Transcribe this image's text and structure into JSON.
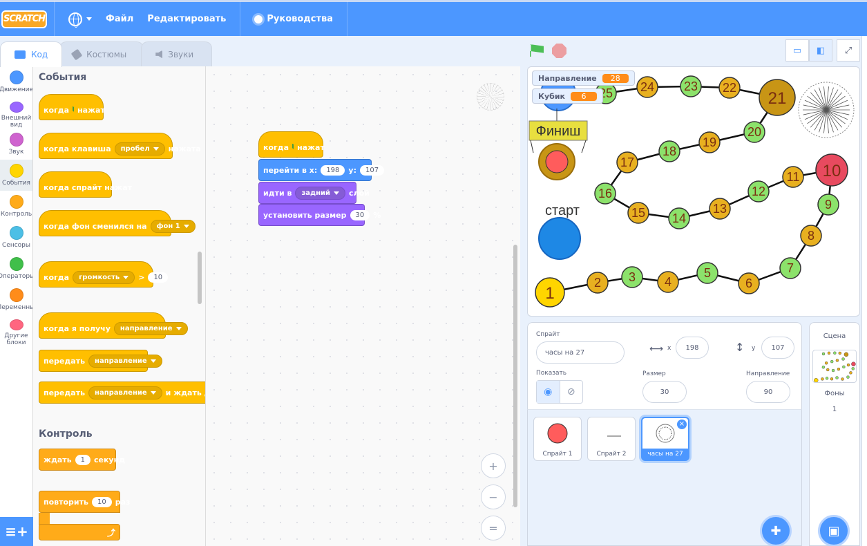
{
  "menu": {
    "logo": "SCRATCH",
    "file": "Файл",
    "edit": "Редактировать",
    "tutorials": "Руководства"
  },
  "tabs": {
    "code": "Код",
    "costumes": "Костюмы",
    "sounds": "Звуки"
  },
  "categories": [
    {
      "label": "Движение",
      "color": "#4c97ff"
    },
    {
      "label": "Внешний вид",
      "color": "#9966ff"
    },
    {
      "label": "Звук",
      "color": "#cf63cf"
    },
    {
      "label": "События",
      "color": "#ffd500"
    },
    {
      "label": "Контроль",
      "color": "#ffab19"
    },
    {
      "label": "Сенсоры",
      "color": "#4cbfe6"
    },
    {
      "label": "Операторы",
      "color": "#40bf4a"
    },
    {
      "label": "Переменные",
      "color": "#ff8c1a"
    },
    {
      "label": "Другие блоки",
      "color": "#ff6680"
    }
  ],
  "palette": {
    "events_title": "События",
    "when_flag": "когда",
    "when_flag_suffix": "нажат",
    "when_key": "когда клавиша",
    "key_value": "пробел",
    "when_key_suffix": "нажата",
    "when_sprite_clicked": "когда спрайт нажат",
    "when_backdrop": "когда фон сменился на",
    "backdrop_value": "фон 1",
    "when_loudness": "когда",
    "loudness_value": "громкость",
    "gt": ">",
    "loudness_num": "10",
    "when_receive": "когда я получу",
    "receive_value": "направление",
    "broadcast": "передать",
    "broadcast_value": "направление",
    "broadcast_wait": "передать",
    "broadcast_wait_value": "направление",
    "broadcast_wait_suffix": "и ждать до конца",
    "control_title": "Контроль",
    "wait": "ждать",
    "wait_value": "1",
    "wait_suffix": "секунд",
    "repeat": "повторить",
    "repeat_value": "10",
    "repeat_suffix": "раз"
  },
  "script": {
    "hat": "когда",
    "hat_suffix": "нажат",
    "goto": "перейти в x:",
    "goto_x": "198",
    "goto_y_label": "y:",
    "goto_y": "107",
    "layer": "идти в",
    "layer_value": "задний",
    "layer_suffix": "слой",
    "size": "установить размер",
    "size_value": "30",
    "size_suffix": "%"
  },
  "zoom": {
    "in": "+",
    "out": "−",
    "reset": "="
  },
  "stage": {
    "monitors": [
      {
        "label": "Направление",
        "value": "28"
      },
      {
        "label": "Кубик",
        "value": "6"
      }
    ],
    "finish": "Финиш",
    "start": "старт",
    "nodes": [
      "1",
      "2",
      "3",
      "4",
      "5",
      "6",
      "7",
      "8",
      "9",
      "10",
      "11",
      "12",
      "13",
      "14",
      "15",
      "16",
      "17",
      "18",
      "19",
      "20",
      "21",
      "22",
      "23",
      "24",
      "25"
    ]
  },
  "sprite_info": {
    "sprite_label": "Спрайт",
    "sprite_name": "часы на 27",
    "x_label": "x",
    "x_value": "198",
    "y_label": "y",
    "y_value": "107",
    "show_label": "Показать",
    "size_label": "Размер",
    "size_value": "30",
    "direction_label": "Направление",
    "direction_value": "90"
  },
  "sprites": [
    {
      "name": "Спрайт 1"
    },
    {
      "name": "Спрайт 2"
    },
    {
      "name": "часы на 27"
    }
  ],
  "scene": {
    "title": "Сцена",
    "backdrops_label": "Фоны",
    "backdrops_count": "1"
  }
}
